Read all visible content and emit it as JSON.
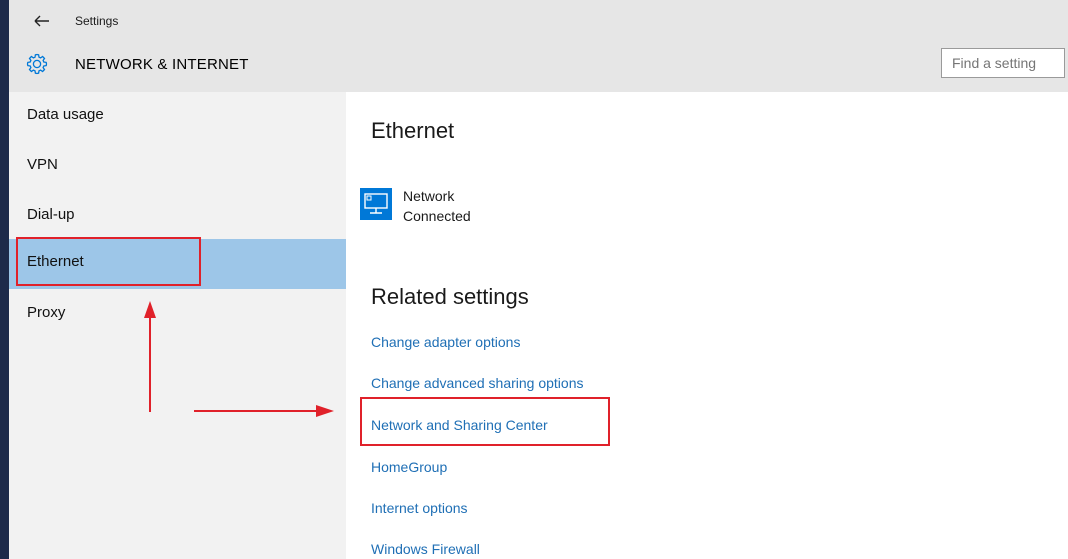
{
  "window": {
    "app_title": "Settings",
    "section_title": "NETWORK & INTERNET",
    "search_placeholder": "Find a setting"
  },
  "sidebar": {
    "items": [
      {
        "label": "Data usage"
      },
      {
        "label": "VPN"
      },
      {
        "label": "Dial-up"
      },
      {
        "label": "Ethernet",
        "selected": true
      },
      {
        "label": "Proxy"
      }
    ]
  },
  "main": {
    "heading": "Ethernet",
    "network": {
      "name": "Network",
      "status": "Connected",
      "icon": "ethernet-monitor-icon"
    },
    "related_heading": "Related settings",
    "links": [
      {
        "label": "Change adapter options"
      },
      {
        "label": "Change advanced sharing options"
      },
      {
        "label": "Network and Sharing Center"
      },
      {
        "label": "HomeGroup"
      },
      {
        "label": "Internet options"
      },
      {
        "label": "Windows Firewall"
      }
    ]
  },
  "colors": {
    "accent": "#0078d7",
    "selected_bg": "#9dc6e8",
    "link": "#1f6fb5",
    "annotation": "#e0212a",
    "header_bg": "#e6e6e6",
    "sidebar_bg": "#f2f2f2"
  },
  "icons": [
    "back-arrow-icon",
    "gear-icon",
    "ethernet-monitor-icon"
  ]
}
